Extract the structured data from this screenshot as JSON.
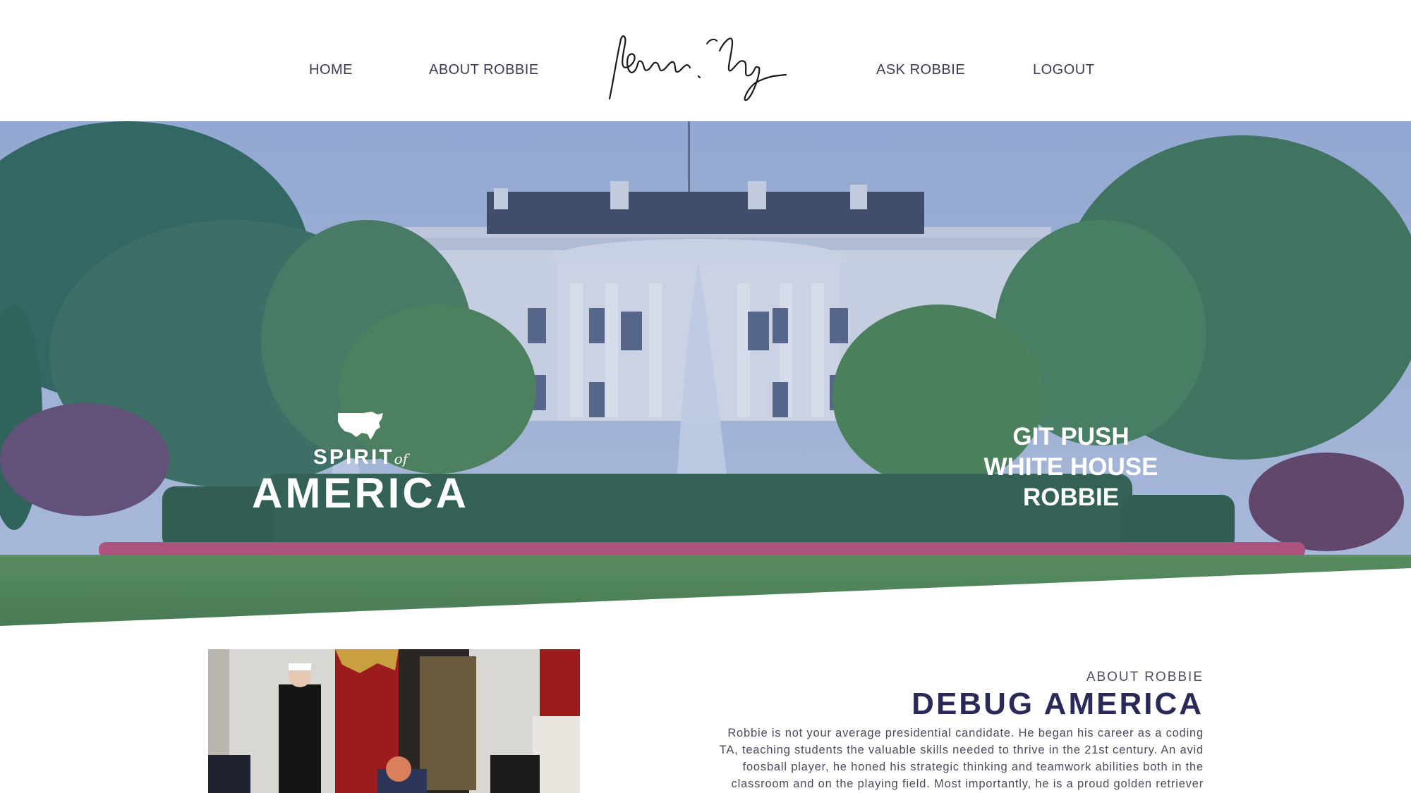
{
  "nav": {
    "home": "HOME",
    "about": "ABOUT ROBBIE",
    "ask": "ASK ROBBIE",
    "logout": "LOGOUT"
  },
  "hero": {
    "spirit_word": "SPIRIT",
    "of_word": "of",
    "america_word": "AMERICA",
    "git_lines": [
      "GIT PUSH",
      "WHITE HOUSE",
      "ROBBIE"
    ]
  },
  "about": {
    "eyebrow": "ABOUT ROBBIE",
    "title": "DEBUG AMERICA",
    "body_lines": [
      "Robbie is not your average presidential candidate. He began his career as a coding",
      "TA, teaching students the valuable skills needed to thrive in the 21st century. An avid",
      "foosball player, he honed his strategic thinking and teamwork abilities both in the",
      "classroom and on the playing field. Most importantly, he is a proud golden retriever"
    ]
  },
  "icons": {
    "signature": "signature-logo",
    "map": "usa-map-icon"
  },
  "colors": {
    "nav_text": "#3d3a5c",
    "title": "#2a2a5a",
    "overlay": "#465fa0"
  }
}
